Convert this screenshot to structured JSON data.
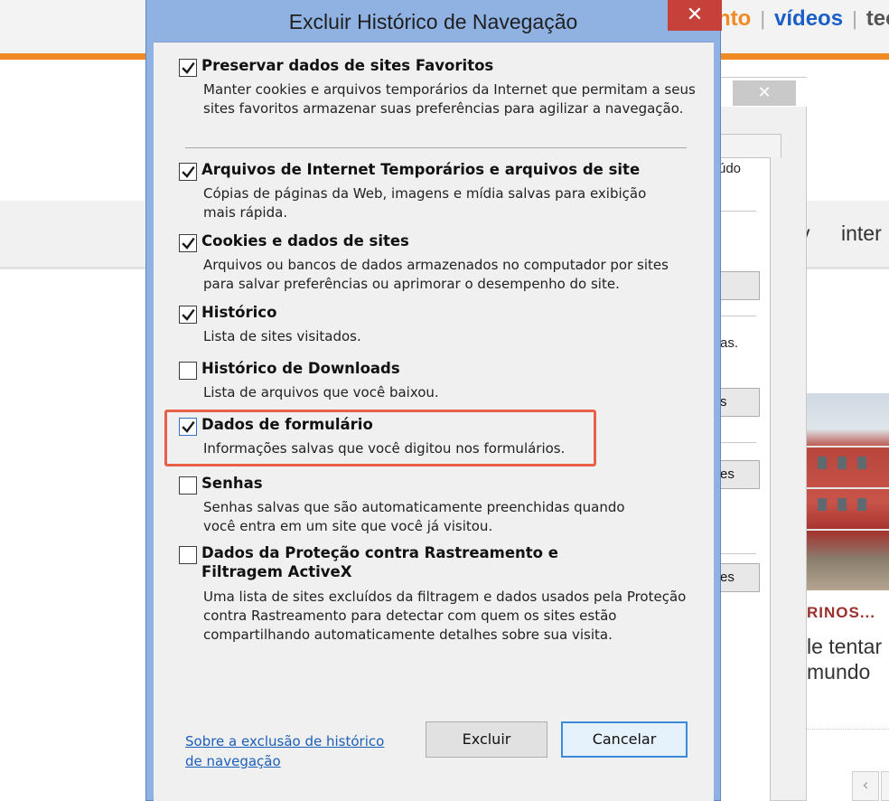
{
  "background": {
    "nav": [
      "nto",
      "vídeos",
      "tec"
    ],
    "nav_text": [
      "v",
      "inter"
    ],
    "italic_text": "ı",
    "article_title": "RINOS...",
    "article_lines": [
      "le tentar",
      "mundo"
    ],
    "scroll_left": "‹"
  },
  "underlying_dialog": {
    "close": "✕",
    "texts": [
      "údo",
      "as."
    ],
    "buttons": [
      "s",
      "es",
      "es"
    ]
  },
  "dialog": {
    "title": "Excluir Histórico de Navegação",
    "close": "✕",
    "options": [
      {
        "title": "Preservar dados de sites Favoritos",
        "checked": true,
        "desc": [
          "Manter cookies e arquivos temporários da Internet que permitam a seus",
          "sites favoritos armazenar suas preferências para agilizar a navegação."
        ]
      },
      {
        "title": "Arquivos de Internet Temporários e arquivos de site",
        "checked": true,
        "desc": [
          "Cópias de páginas da Web, imagens e mídia salvas para exibição",
          "mais rápida."
        ]
      },
      {
        "title": "Cookies e dados de sites",
        "checked": true,
        "desc": [
          "Arquivos ou bancos de dados armazenados no computador por sites",
          "para salvar preferências ou aprimorar o desempenho do site."
        ]
      },
      {
        "title": "Histórico",
        "checked": true,
        "desc": [
          "Lista de sites visitados."
        ]
      },
      {
        "title": "Histórico de Downloads",
        "checked": false,
        "desc": [
          "Lista de arquivos que você baixou."
        ]
      },
      {
        "title": "Dados de formulário",
        "checked": true,
        "desc": [
          "Informações salvas que você digitou nos formulários."
        ]
      },
      {
        "title": "Senhas",
        "checked": false,
        "desc": [
          "Senhas salvas que são automaticamente preenchidas quando",
          "você entra em um site que você já visitou."
        ]
      },
      {
        "title": "Dados da Proteção contra Rastreamento e",
        "title2": "Filtragem ActiveX",
        "checked": false,
        "desc": [
          "Uma lista de sites excluídos da filtragem e dados usados pela Proteção",
          "contra Rastreamento para detectar com quem os sites estão",
          "compartilhando automaticamente detalhes sobre sua visita."
        ]
      }
    ],
    "help_link": [
      "Sobre a exclusão de histórico",
      "de navegação"
    ],
    "buttons": {
      "delete": "Excluir",
      "cancel": "Cancelar"
    }
  },
  "colors": {
    "dialog_frame": "#8fb2e2",
    "close_button": "#c7413b",
    "highlight": "#e8604a",
    "link": "#1b5fb8",
    "orange_bar": "#f08a24",
    "nav_orange": "#f08a24",
    "nav_blue": "#1a5fc8",
    "nav_gray": "#555555"
  }
}
